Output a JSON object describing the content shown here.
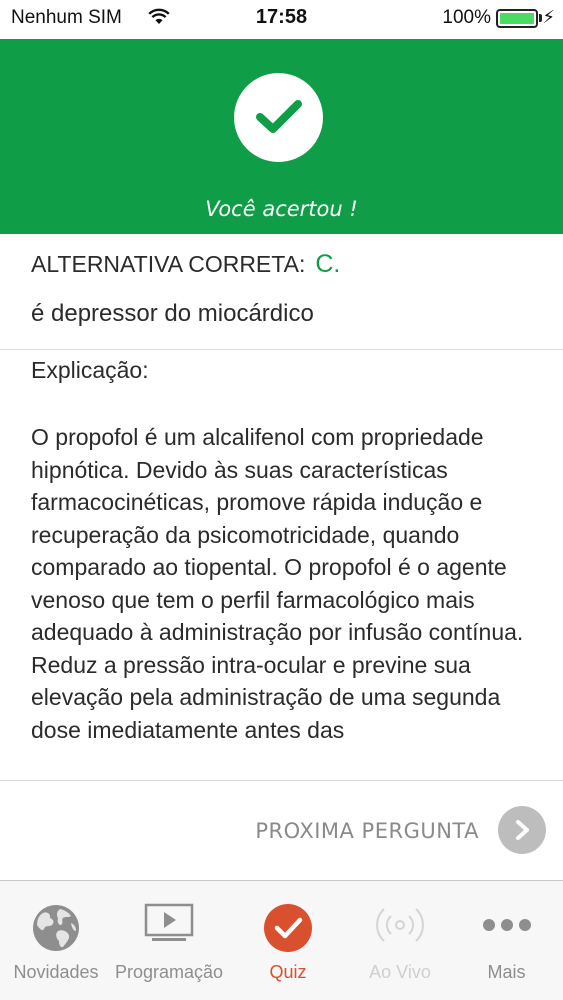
{
  "status_bar": {
    "carrier": "Nenhum SIM",
    "time": "17:58",
    "battery": "100%"
  },
  "result": {
    "message": "Você acertou !",
    "color": "#0f9d48"
  },
  "answer": {
    "label": "ALTERNATIVA CORRETA:",
    "letter": "C.",
    "text": "é depressor do miocárdico"
  },
  "explanation": {
    "label": "Explicação:",
    "body": "O propofol é um alcalifenol com propriedade hipnótica. Devido às suas características farmacocinéticas, promove rápida indução e recuperação da psicomotricidade, quando comparado ao tiopental. O propofol é o agente venoso que tem o perfil farmacológico mais adequado à administração por infusão contínua. Reduz a pressão intra-ocular e previne sua elevação pela administração de uma segunda dose imediatamente antes das"
  },
  "next": {
    "label": "PROXIMA PERGUNTA"
  },
  "tabs": [
    {
      "label": "Novidades",
      "icon": "globe-icon"
    },
    {
      "label": "Programação",
      "icon": "tv-icon"
    },
    {
      "label": "Quiz",
      "icon": "check-circle-icon"
    },
    {
      "label": "Ao Vivo",
      "icon": "broadcast-icon"
    },
    {
      "label": "Mais",
      "icon": "more-icon"
    }
  ],
  "colors": {
    "accent": "#d9502f",
    "success": "#0f9d48"
  }
}
